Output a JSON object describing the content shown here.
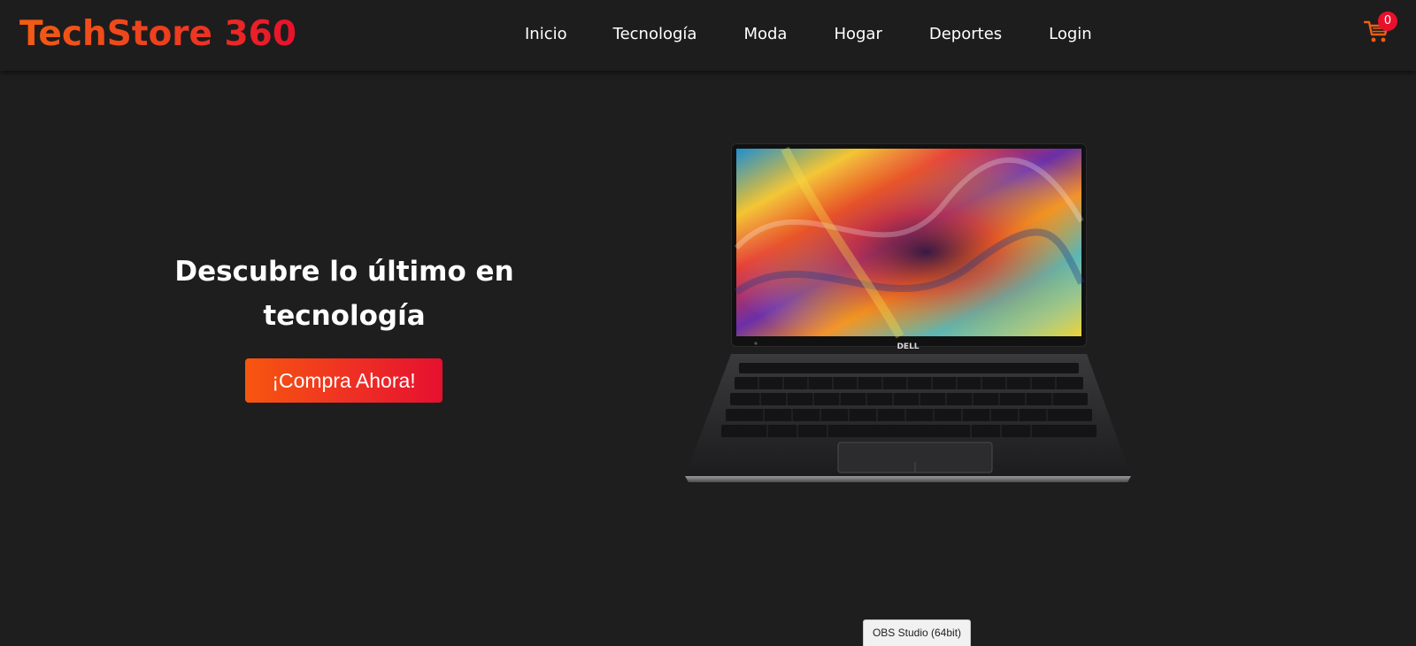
{
  "brand": {
    "name": "TechStore 360",
    "gradient_start": "#f25c14",
    "gradient_end": "#e8102c"
  },
  "nav": {
    "items": [
      {
        "label": "Inicio"
      },
      {
        "label": "Tecnología"
      },
      {
        "label": "Moda"
      },
      {
        "label": "Hogar"
      },
      {
        "label": "Deportes"
      },
      {
        "label": "Login"
      }
    ]
  },
  "cart": {
    "icon": "shopping-cart-icon",
    "count": "0",
    "color": "#f25c14",
    "badge_color": "#e8102c"
  },
  "hero": {
    "title": "Descubre lo último en tecnología",
    "cta_label": "¡Compra Ahora!",
    "image": "laptop-product-image",
    "laptop_logo": "DELL"
  },
  "taskbar_tooltip": {
    "text": "OBS Studio (64bit)"
  },
  "colors": {
    "background": "#1e1e1e",
    "navbar": "#1d1d1d",
    "text": "#ffffff"
  }
}
